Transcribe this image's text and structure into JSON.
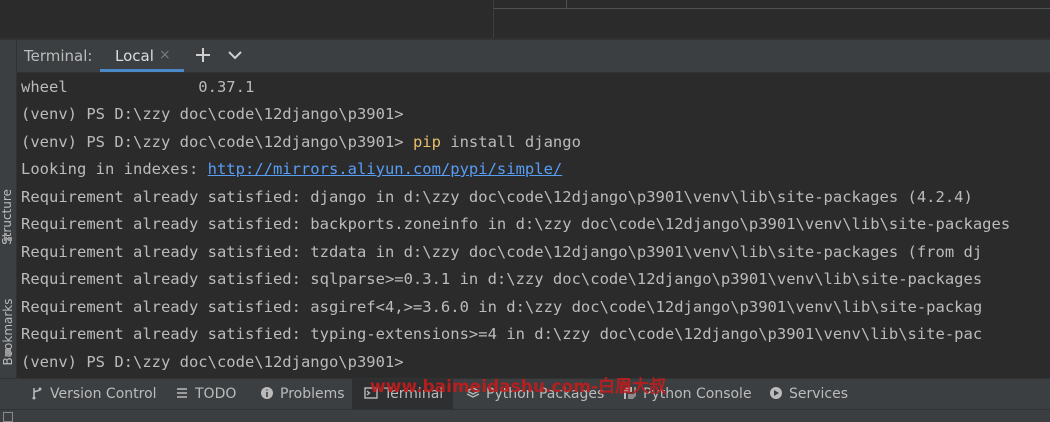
{
  "left_strip": {
    "structure_label": "Structure",
    "bookmarks_label": "Bookmarks"
  },
  "terminal": {
    "header_label": "Terminal:",
    "tab_label": "Local",
    "tab_close": "×",
    "new_tab": "+",
    "dropdown": "⌄",
    "lines": [
      {
        "plain": "wheel              0.37.1"
      },
      {
        "plain": "(venv) PS D:\\zzy doc\\code\\12django\\p3901>"
      },
      {
        "prefix": "(venv) PS D:\\zzy doc\\code\\12django\\p3901> ",
        "cmd": "pip",
        "rest": " install django"
      },
      {
        "prefix": "Looking in indexes: ",
        "link": "http://mirrors.aliyun.com/pypi/simple/"
      },
      {
        "plain": "Requirement already satisfied: django in d:\\zzy doc\\code\\12django\\p3901\\venv\\lib\\site-packages (4.2.4)"
      },
      {
        "plain": "Requirement already satisfied: backports.zoneinfo in d:\\zzy doc\\code\\12django\\p3901\\venv\\lib\\site-packages"
      },
      {
        "plain": "Requirement already satisfied: tzdata in d:\\zzy doc\\code\\12django\\p3901\\venv\\lib\\site-packages (from dj"
      },
      {
        "plain": "Requirement already satisfied: sqlparse>=0.3.1 in d:\\zzy doc\\code\\12django\\p3901\\venv\\lib\\site-packages"
      },
      {
        "plain": "Requirement already satisfied: asgiref<4,>=3.6.0 in d:\\zzy doc\\code\\12django\\p3901\\venv\\lib\\site-packag"
      },
      {
        "plain": "Requirement already satisfied: typing-extensions>=4 in d:\\zzy doc\\code\\12django\\p3901\\venv\\lib\\site-pac"
      },
      {
        "plain": "(venv) PS D:\\zzy doc\\code\\12django\\p3901>"
      }
    ]
  },
  "bottom_bar": {
    "items": [
      {
        "label": "Version Control",
        "icon": "branch-icon"
      },
      {
        "label": "TODO",
        "icon": "list-icon"
      },
      {
        "label": "Problems",
        "icon": "info-icon"
      },
      {
        "label": "Terminal",
        "icon": "terminal-icon"
      },
      {
        "label": "Python Packages",
        "icon": "layers-icon"
      },
      {
        "label": "Python Console",
        "icon": "python-icon"
      },
      {
        "label": "Services",
        "icon": "services-icon"
      }
    ]
  },
  "watermark": "www.baimeidashu.com-白眉大叔",
  "colors": {
    "background": "#2b2b2b",
    "panel": "#3c3f41",
    "text": "#bbbbbb",
    "command": "#e8bf6a",
    "link": "#589df6",
    "tab_underline": "#4a88c7",
    "watermark": "#c01d1d"
  }
}
